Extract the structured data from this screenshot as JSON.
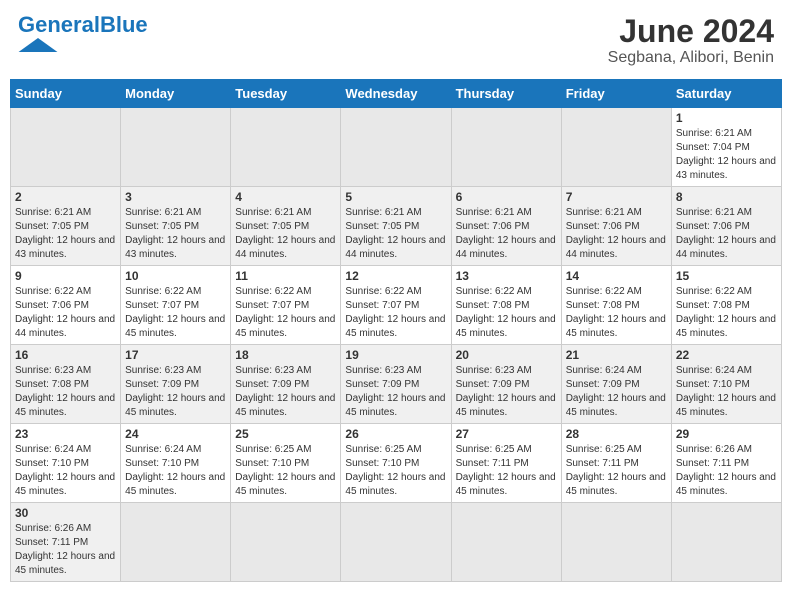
{
  "header": {
    "logo_general": "General",
    "logo_blue": "Blue",
    "month_year": "June 2024",
    "location": "Segbana, Alibori, Benin"
  },
  "days_of_week": [
    "Sunday",
    "Monday",
    "Tuesday",
    "Wednesday",
    "Thursday",
    "Friday",
    "Saturday"
  ],
  "weeks": [
    {
      "days": [
        {
          "num": "",
          "info": ""
        },
        {
          "num": "",
          "info": ""
        },
        {
          "num": "",
          "info": ""
        },
        {
          "num": "",
          "info": ""
        },
        {
          "num": "",
          "info": ""
        },
        {
          "num": "",
          "info": ""
        },
        {
          "num": "1",
          "info": "Sunrise: 6:21 AM\nSunset: 7:04 PM\nDaylight: 12 hours and 43 minutes."
        }
      ]
    },
    {
      "days": [
        {
          "num": "2",
          "info": "Sunrise: 6:21 AM\nSunset: 7:05 PM\nDaylight: 12 hours and 43 minutes."
        },
        {
          "num": "3",
          "info": "Sunrise: 6:21 AM\nSunset: 7:05 PM\nDaylight: 12 hours and 43 minutes."
        },
        {
          "num": "4",
          "info": "Sunrise: 6:21 AM\nSunset: 7:05 PM\nDaylight: 12 hours and 44 minutes."
        },
        {
          "num": "5",
          "info": "Sunrise: 6:21 AM\nSunset: 7:05 PM\nDaylight: 12 hours and 44 minutes."
        },
        {
          "num": "6",
          "info": "Sunrise: 6:21 AM\nSunset: 7:06 PM\nDaylight: 12 hours and 44 minutes."
        },
        {
          "num": "7",
          "info": "Sunrise: 6:21 AM\nSunset: 7:06 PM\nDaylight: 12 hours and 44 minutes."
        },
        {
          "num": "8",
          "info": "Sunrise: 6:21 AM\nSunset: 7:06 PM\nDaylight: 12 hours and 44 minutes."
        }
      ]
    },
    {
      "days": [
        {
          "num": "9",
          "info": "Sunrise: 6:22 AM\nSunset: 7:06 PM\nDaylight: 12 hours and 44 minutes."
        },
        {
          "num": "10",
          "info": "Sunrise: 6:22 AM\nSunset: 7:07 PM\nDaylight: 12 hours and 45 minutes."
        },
        {
          "num": "11",
          "info": "Sunrise: 6:22 AM\nSunset: 7:07 PM\nDaylight: 12 hours and 45 minutes."
        },
        {
          "num": "12",
          "info": "Sunrise: 6:22 AM\nSunset: 7:07 PM\nDaylight: 12 hours and 45 minutes."
        },
        {
          "num": "13",
          "info": "Sunrise: 6:22 AM\nSunset: 7:08 PM\nDaylight: 12 hours and 45 minutes."
        },
        {
          "num": "14",
          "info": "Sunrise: 6:22 AM\nSunset: 7:08 PM\nDaylight: 12 hours and 45 minutes."
        },
        {
          "num": "15",
          "info": "Sunrise: 6:22 AM\nSunset: 7:08 PM\nDaylight: 12 hours and 45 minutes."
        }
      ]
    },
    {
      "days": [
        {
          "num": "16",
          "info": "Sunrise: 6:23 AM\nSunset: 7:08 PM\nDaylight: 12 hours and 45 minutes."
        },
        {
          "num": "17",
          "info": "Sunrise: 6:23 AM\nSunset: 7:09 PM\nDaylight: 12 hours and 45 minutes."
        },
        {
          "num": "18",
          "info": "Sunrise: 6:23 AM\nSunset: 7:09 PM\nDaylight: 12 hours and 45 minutes."
        },
        {
          "num": "19",
          "info": "Sunrise: 6:23 AM\nSunset: 7:09 PM\nDaylight: 12 hours and 45 minutes."
        },
        {
          "num": "20",
          "info": "Sunrise: 6:23 AM\nSunset: 7:09 PM\nDaylight: 12 hours and 45 minutes."
        },
        {
          "num": "21",
          "info": "Sunrise: 6:24 AM\nSunset: 7:09 PM\nDaylight: 12 hours and 45 minutes."
        },
        {
          "num": "22",
          "info": "Sunrise: 6:24 AM\nSunset: 7:10 PM\nDaylight: 12 hours and 45 minutes."
        }
      ]
    },
    {
      "days": [
        {
          "num": "23",
          "info": "Sunrise: 6:24 AM\nSunset: 7:10 PM\nDaylight: 12 hours and 45 minutes."
        },
        {
          "num": "24",
          "info": "Sunrise: 6:24 AM\nSunset: 7:10 PM\nDaylight: 12 hours and 45 minutes."
        },
        {
          "num": "25",
          "info": "Sunrise: 6:25 AM\nSunset: 7:10 PM\nDaylight: 12 hours and 45 minutes."
        },
        {
          "num": "26",
          "info": "Sunrise: 6:25 AM\nSunset: 7:10 PM\nDaylight: 12 hours and 45 minutes."
        },
        {
          "num": "27",
          "info": "Sunrise: 6:25 AM\nSunset: 7:11 PM\nDaylight: 12 hours and 45 minutes."
        },
        {
          "num": "28",
          "info": "Sunrise: 6:25 AM\nSunset: 7:11 PM\nDaylight: 12 hours and 45 minutes."
        },
        {
          "num": "29",
          "info": "Sunrise: 6:26 AM\nSunset: 7:11 PM\nDaylight: 12 hours and 45 minutes."
        }
      ]
    },
    {
      "days": [
        {
          "num": "30",
          "info": "Sunrise: 6:26 AM\nSunset: 7:11 PM\nDaylight: 12 hours and 45 minutes."
        },
        {
          "num": "",
          "info": ""
        },
        {
          "num": "",
          "info": ""
        },
        {
          "num": "",
          "info": ""
        },
        {
          "num": "",
          "info": ""
        },
        {
          "num": "",
          "info": ""
        },
        {
          "num": "",
          "info": ""
        }
      ]
    }
  ]
}
